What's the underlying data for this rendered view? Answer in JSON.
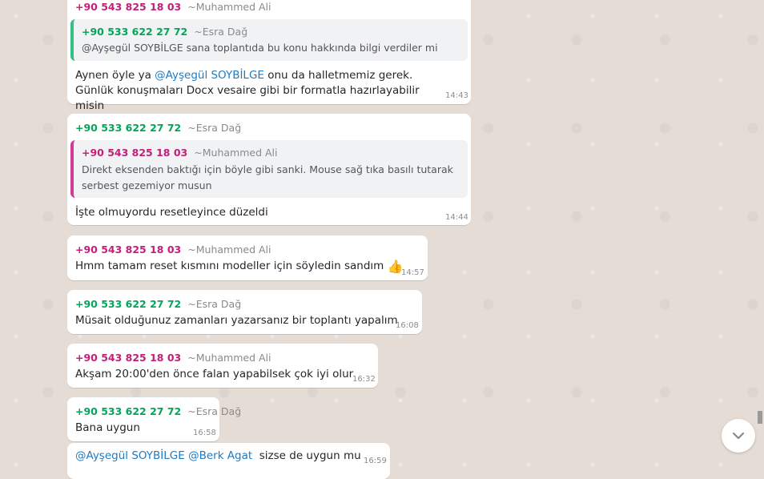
{
  "messages": [
    {
      "sender_phone": "+90 543 825 18 03",
      "sender_name": "~Muhammed Ali",
      "quote_sender_phone": "+90 533 622 27 72",
      "quote_sender_name": "~Esra Dağ",
      "quote_text": "@Ayşegül SOYBİLGE sana toplantıda bu konu hakkında bilgi verdiler mi",
      "text_before": "Aynen öyle ya ",
      "mention": "@Ayşegül SOYBİLGE",
      "text_after": " onu da halletmemiz gerek. Günlük konuşmaları Docx vesaire gibi bir formatla hazırlayabilir misin",
      "time": "14:43"
    },
    {
      "sender_phone": "+90 533 622 27 72",
      "sender_name": "~Esra Dağ",
      "quote_sender_phone": "+90 543 825 18 03",
      "quote_sender_name": "~Muhammed Ali",
      "quote_text": "Direkt eksenden baktığı için böyle gibi sanki. Mouse sağ tıka basılı tutarak serbest gezemiyor musun",
      "text": "İşte olmuyordu resetleyince düzeldi",
      "time": "14:44"
    },
    {
      "sender_phone": "+90 543 825 18 03",
      "sender_name": "~Muhammed Ali",
      "text": "Hmm tamam reset kısmını modeller için söyledin sandım",
      "emoji": "👍",
      "time": "14:57"
    },
    {
      "sender_phone": "+90 533 622 27 72",
      "sender_name": "~Esra Dağ",
      "text": "Müsait olduğunuz zamanları yazarsanız bir toplantı yapalım",
      "time": "16:08"
    },
    {
      "sender_phone": "+90 543 825 18 03",
      "sender_name": "~Muhammed Ali",
      "text": "Akşam 20:00'den önce falan yapabilsek çok iyi olur",
      "time": "16:32"
    },
    {
      "sender_phone": "+90 533 622 27 72",
      "sender_name": "~Esra Dağ",
      "text": "Bana uygun",
      "time": "16:58"
    },
    {
      "mention1": "@Ayşegül SOYBİLGE",
      "mention2": "@Berk Agat",
      "text": "  sizse de uygun mu",
      "time": "16:59"
    }
  ],
  "colors": {
    "pink": "#c41e79",
    "green": "#06a35a",
    "mention": "#1f7bc1",
    "background": "#e5ddd5"
  },
  "icons": {
    "scroll_down": "chevron-down-icon"
  }
}
